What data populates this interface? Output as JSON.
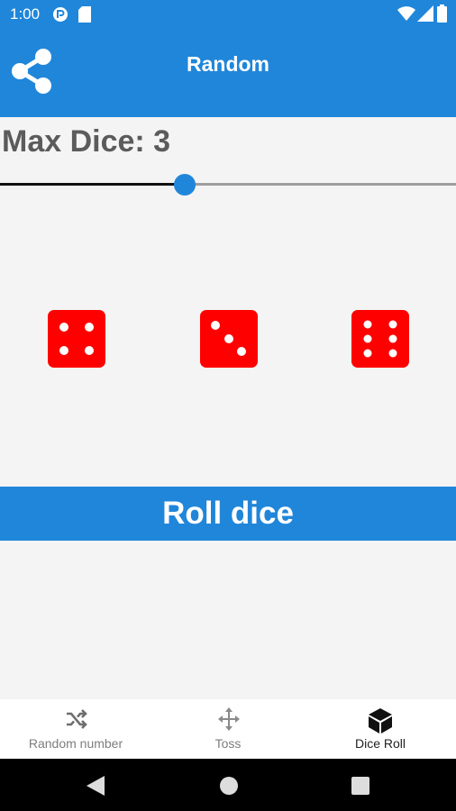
{
  "status_bar": {
    "time": "1:00",
    "left_icons": [
      "app-notification-icon",
      "sd-card-icon"
    ],
    "right_icons": [
      "wifi-icon",
      "cellular-signal-icon",
      "battery-icon"
    ]
  },
  "app_bar": {
    "title": "Random",
    "share_icon": "share-icon",
    "color": "#2086da"
  },
  "dice_settings": {
    "max_dice_label": "Max Dice: 3",
    "slider_fraction": 0.4
  },
  "dice": {
    "color": "#ff0000",
    "faces": [
      4,
      3,
      6
    ]
  },
  "roll_button": {
    "label": "Roll dice"
  },
  "bottom_nav": {
    "tabs": [
      {
        "label": "Random number",
        "icon": "shuffle-icon",
        "active": false
      },
      {
        "label": "Toss",
        "icon": "move-arrows-icon",
        "active": false
      },
      {
        "label": "Dice Roll",
        "icon": "cube-icon",
        "active": true
      }
    ]
  },
  "system_nav": {
    "buttons": [
      "back-icon",
      "home-icon",
      "recents-icon"
    ]
  }
}
